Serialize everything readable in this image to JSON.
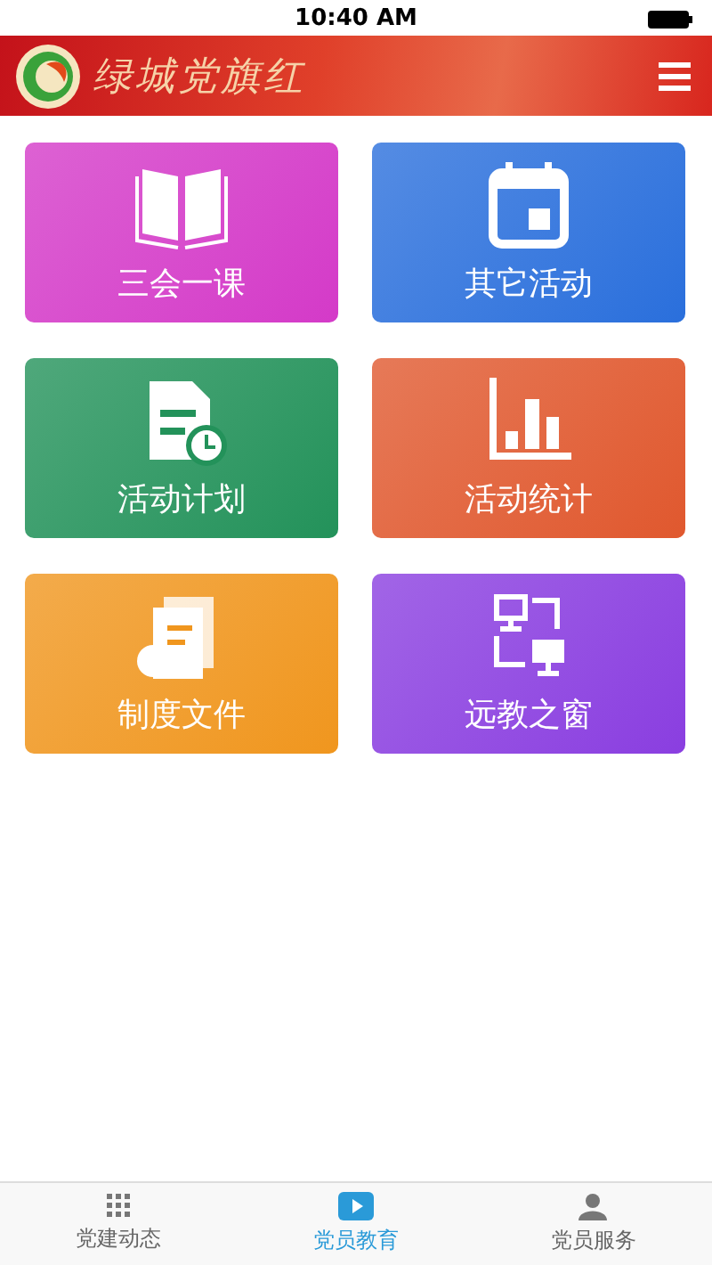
{
  "status_bar": {
    "time": "10:40 AM"
  },
  "header": {
    "title": "绿城党旗红"
  },
  "tiles": [
    {
      "label": "三会一课",
      "color": "#d43ac8"
    },
    {
      "label": "其它活动",
      "color": "#2a6fdc"
    },
    {
      "label": "活动计划",
      "color": "#23925a"
    },
    {
      "label": "活动统计",
      "color": "#e0582e"
    },
    {
      "label": "制度文件",
      "color": "#f0961e"
    },
    {
      "label": "远教之窗",
      "color": "#8a3ee0"
    }
  ],
  "tab_bar": [
    {
      "label": "党建动态",
      "selected": false
    },
    {
      "label": "党员教育",
      "selected": true
    },
    {
      "label": "党员服务",
      "selected": false
    }
  ]
}
